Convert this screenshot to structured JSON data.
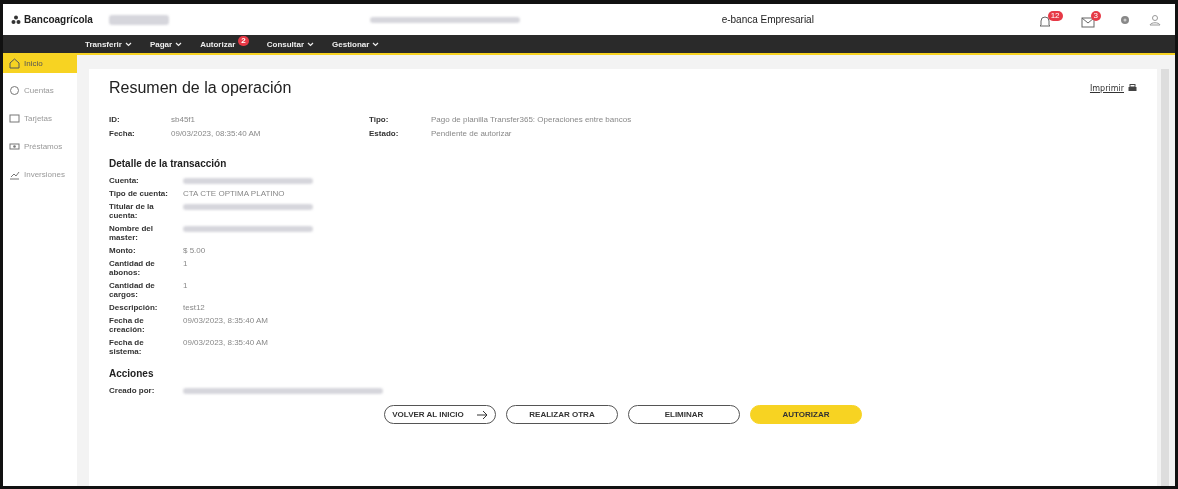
{
  "header": {
    "logo": "Bancoagrícola",
    "app_title": "e-banca Empresarial",
    "notifications": [
      {
        "kind": "bell",
        "badge": "12"
      },
      {
        "kind": "mail",
        "badge": "3"
      }
    ]
  },
  "nav": {
    "items": [
      {
        "label": "Transferir"
      },
      {
        "label": "Pagar"
      },
      {
        "label": "Autorizar",
        "badge": "2"
      },
      {
        "label": "Consultar"
      },
      {
        "label": "Gestionar"
      }
    ]
  },
  "sidebar": {
    "items": [
      {
        "label": "Inicio",
        "kind": "home",
        "selected": true
      },
      {
        "label": "Cuentas",
        "kind": "coin",
        "selected": false
      },
      {
        "label": "Tarjetas",
        "kind": "card",
        "selected": false
      },
      {
        "label": "Préstamos",
        "kind": "loan",
        "selected": false
      },
      {
        "label": "Inversiones",
        "kind": "invest",
        "selected": false
      }
    ]
  },
  "page": {
    "title": "Resumen de la operación",
    "print_link": "Imprimir",
    "summary": [
      {
        "label": "ID:",
        "value": "sb45f1"
      },
      {
        "label": "Fecha:",
        "value": "09/03/2023, 08:35:40 AM"
      },
      {
        "label": "Tipo:",
        "value": "Pago de planilla Transfer365: Operaciones entre bancos"
      },
      {
        "label": "Estado:",
        "value": "Pendiente de autorizar"
      }
    ],
    "detail_title": "Detalle de la transacción",
    "details": [
      {
        "label": "Cuenta:"
      },
      {
        "label": "Tipo de cuenta:",
        "value": "CTA CTE OPTIMA PLATINO"
      },
      {
        "label": "Titular de la cuenta:"
      },
      {
        "label": "Nombre del master:"
      },
      {
        "label": "Monto:",
        "value": "$ 5.00"
      },
      {
        "label": "Cantidad de abonos:",
        "value": "1"
      },
      {
        "label": "Cantidad de cargos:",
        "value": "1"
      },
      {
        "label": "Descripción:",
        "value": "test12"
      },
      {
        "label": "Fecha de creación:",
        "value": "09/03/2023, 8:35:40 AM"
      },
      {
        "label": "Fecha de sistema:",
        "value": "09/03/2023, 8:35:40 AM"
      }
    ],
    "actions_title": "Acciones",
    "actions": [
      {
        "label": "Creado por:"
      }
    ]
  },
  "buttons": [
    {
      "label": "VOLVER AL INICIO",
      "kind": "arrow"
    },
    {
      "label": "REALIZAR OTRA",
      "kind": "outline"
    },
    {
      "label": "ELIMINAR",
      "kind": "outline"
    },
    {
      "label": "AUTORIZAR",
      "kind": "primary"
    }
  ]
}
